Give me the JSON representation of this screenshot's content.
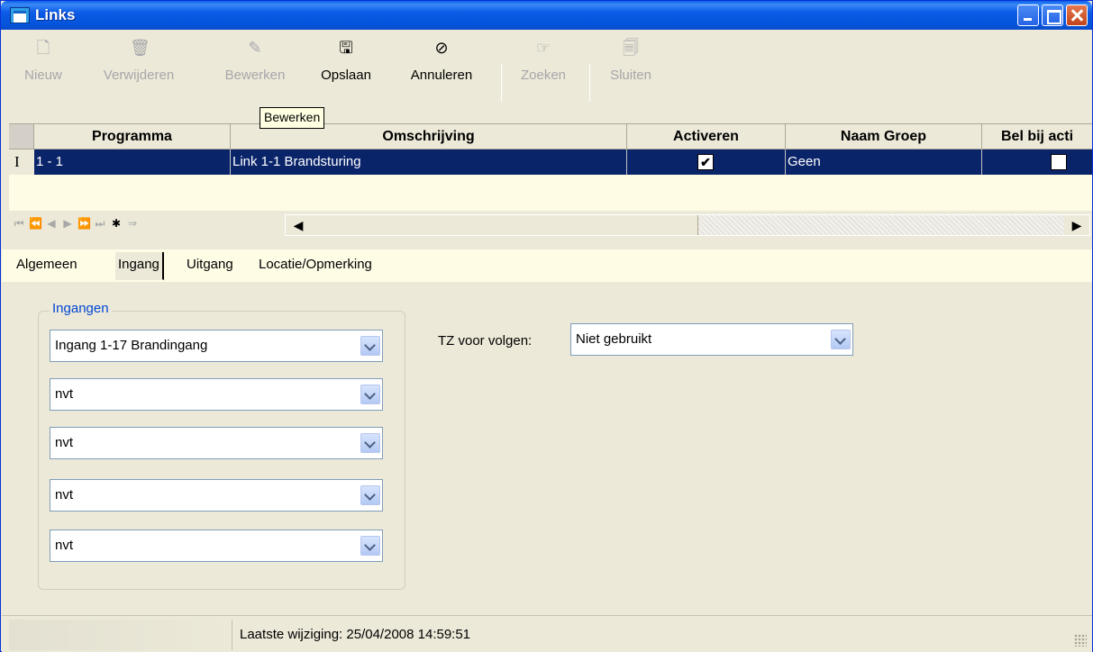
{
  "window": {
    "title": "Links"
  },
  "toolbar": {
    "new": "Nieuw",
    "delete": "Verwijderen",
    "edit": "Bewerken",
    "save": "Opslaan",
    "cancel": "Annuleren",
    "search": "Zoeken",
    "close": "Sluiten"
  },
  "tooltip": "Bewerken",
  "grid": {
    "columns": [
      "Programma",
      "Omschrijving",
      "Activeren",
      "Naam Groep",
      "Bel bij acti"
    ],
    "row": {
      "programma": "1 - 1",
      "omschrijving": "Link 1-1 Brandsturing",
      "activeren": "✔",
      "naam_groep": "Geen",
      "bel": ""
    },
    "row_indicator": "I"
  },
  "tabs": {
    "algemeen": "Algemeen",
    "ingang": "Ingang",
    "uitgang": "Uitgang",
    "locatie": "Locatie/Opmerking"
  },
  "ingangen": {
    "label": "Ingangen",
    "values": [
      "Ingang 1-17 Brandingang",
      "nvt",
      "nvt",
      "nvt",
      "nvt"
    ]
  },
  "tz": {
    "label": "TZ voor volgen:",
    "value": "Niet gebruikt"
  },
  "status": {
    "last_change": "Laatste wijziging: 25/04/2008 14:59:51"
  }
}
